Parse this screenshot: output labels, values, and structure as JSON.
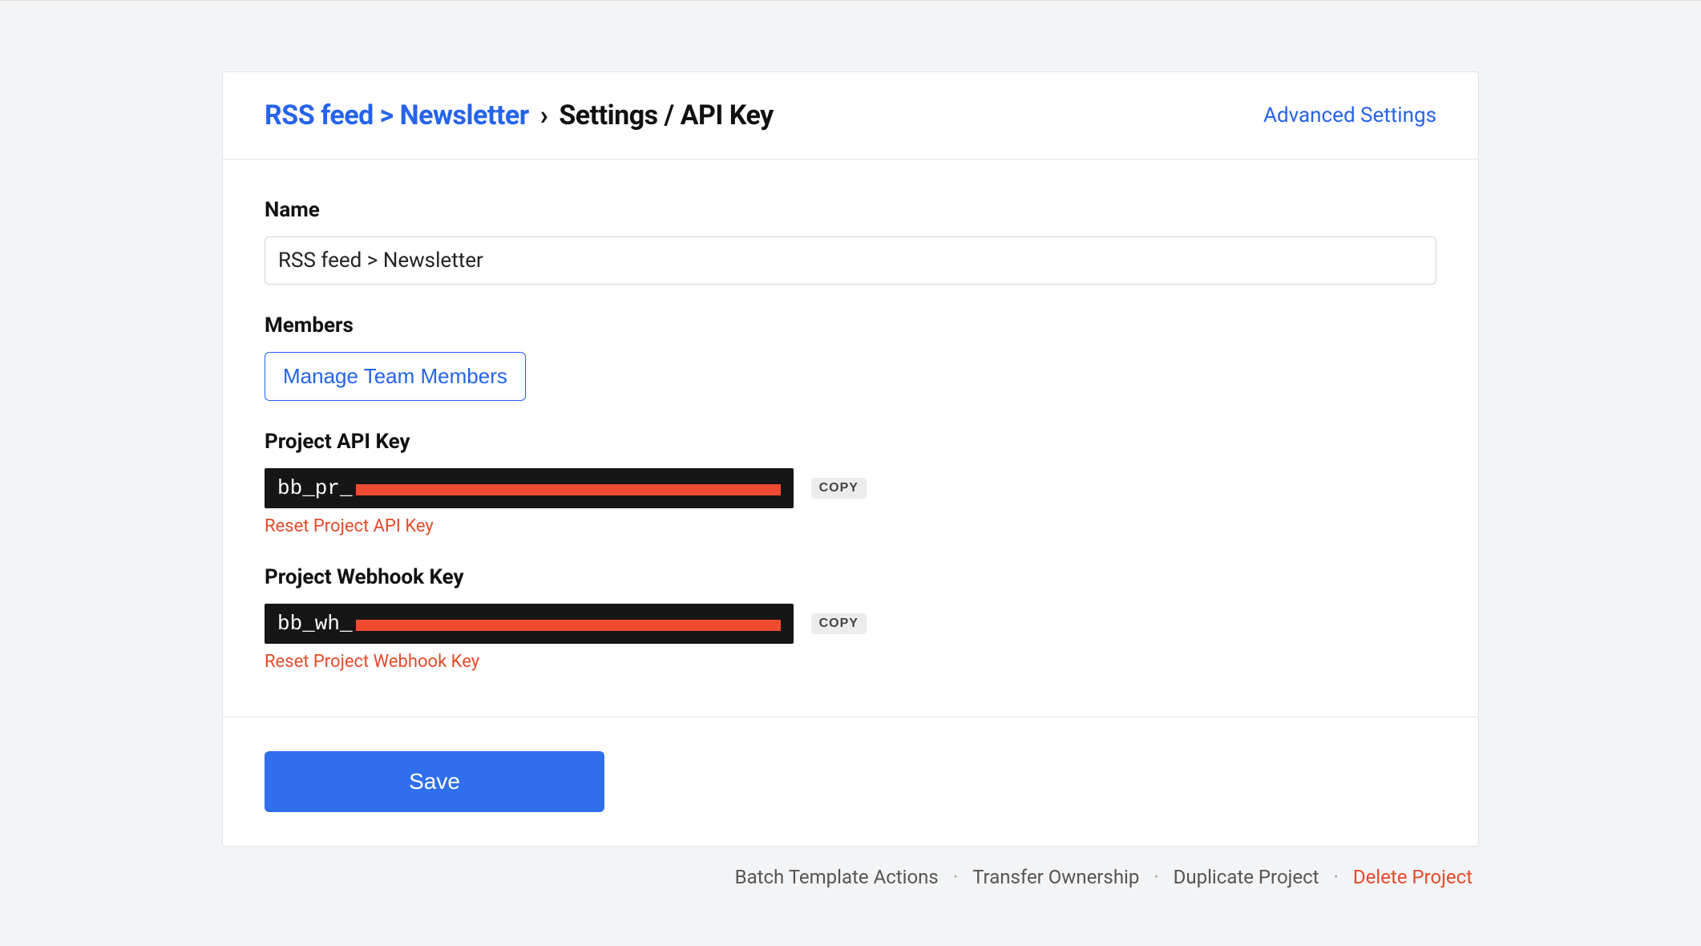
{
  "header": {
    "breadcrumb_link": "RSS feed > Newsletter",
    "breadcrumb_sep": "›",
    "breadcrumb_current": "Settings / API Key",
    "advanced_link": "Advanced Settings"
  },
  "form": {
    "name_label": "Name",
    "name_value": "RSS feed > Newsletter",
    "members_label": "Members",
    "manage_members_btn": "Manage Team Members",
    "api_key_label": "Project API Key",
    "api_key_prefix": "bb_pr_",
    "copy_btn": "COPY",
    "reset_api_key": "Reset Project API Key",
    "webhook_key_label": "Project Webhook Key",
    "webhook_key_prefix": "bb_wh_",
    "reset_webhook_key": "Reset Project Webhook Key"
  },
  "footer": {
    "save_btn": "Save"
  },
  "actions": {
    "batch": "Batch Template Actions",
    "transfer": "Transfer Ownership",
    "duplicate": "Duplicate Project",
    "delete": "Delete Project",
    "dot": "·"
  }
}
